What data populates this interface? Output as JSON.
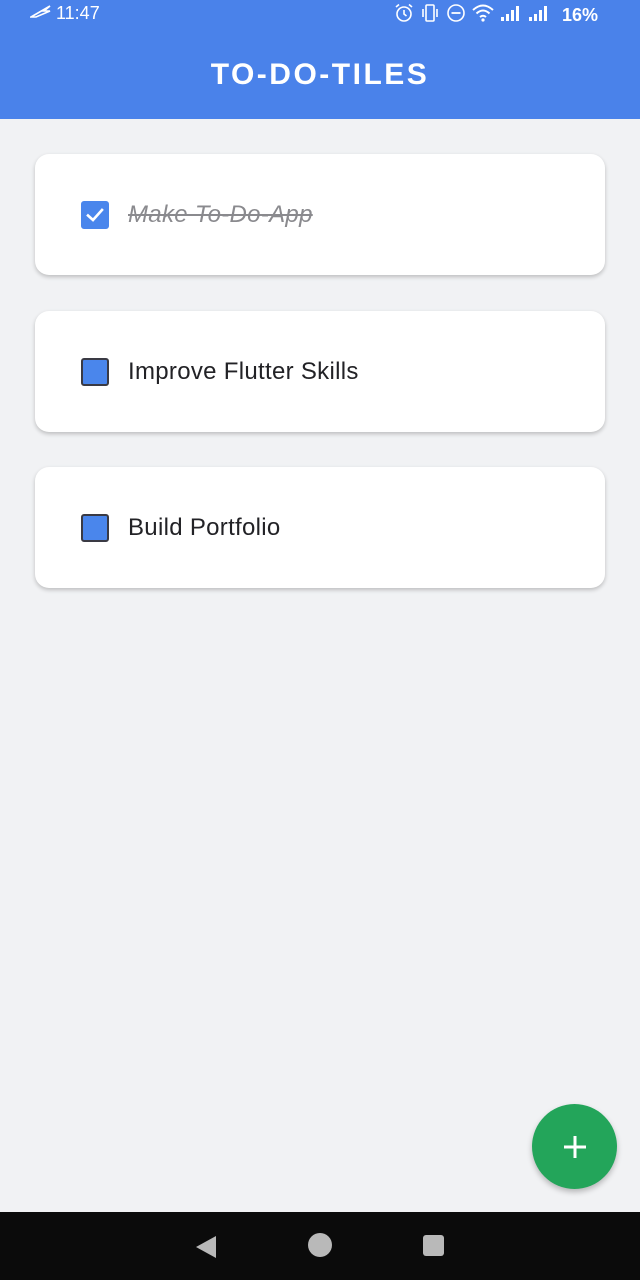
{
  "status_bar": {
    "time": "11:47",
    "battery": "16%",
    "icons": [
      "plane-swoosh-icon",
      "alarm-icon",
      "vibrate-icon",
      "dnd-icon",
      "wifi-icon",
      "signal-icon",
      "signal-icon"
    ]
  },
  "app_bar": {
    "title": "TO-DO-TILES"
  },
  "todos": [
    {
      "text": "Make To-Do-App",
      "done": true
    },
    {
      "text": "Improve Flutter Skills",
      "done": false
    },
    {
      "text": "Build Portfolio",
      "done": false
    }
  ],
  "fab": {
    "icon": "plus-icon"
  },
  "nav_bar": {
    "icons": [
      "back-icon",
      "home-icon",
      "recents-icon"
    ]
  },
  "colors": {
    "primary": "#4a82ea",
    "background": "#f1f2f4",
    "checkbox": "#4a86ec",
    "fab": "#23a55a",
    "nav_bar": "#0b0b0b"
  }
}
